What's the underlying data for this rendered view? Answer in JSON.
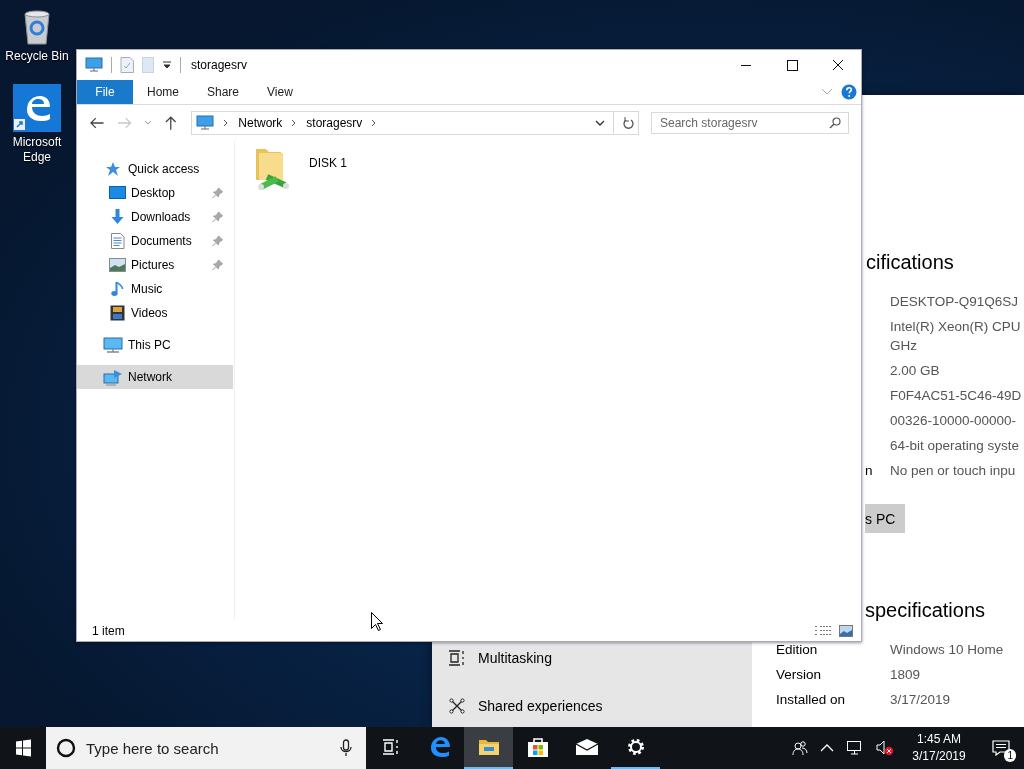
{
  "desktop_icons": [
    {
      "label": "Recycle Bin",
      "kind": "recycle"
    },
    {
      "label": "Microsoft Edge",
      "kind": "edge"
    }
  ],
  "settings_window": {
    "nav_items": [
      {
        "label": "Multitasking",
        "kind": "multitasking"
      },
      {
        "label": "Shared experiences",
        "kind": "shared"
      }
    ],
    "sections": [
      {
        "heading": "cifications",
        "rows": [
          {
            "value": "DESKTOP-Q91Q6SJ"
          },
          {
            "value": "Intel(R) Xeon(R) CPU",
            "value_2": "GHz"
          },
          {
            "value": "2.00 GB"
          },
          {
            "value": "F0F4AC51-5C46-49D"
          },
          {
            "value": "00326-10000-00000-"
          },
          {
            "value": "64-bit operating syste"
          },
          {
            "label": "n",
            "value": "No pen or touch inpu"
          }
        ],
        "button": "s PC"
      },
      {
        "heading": "specifications",
        "rows": [
          {
            "label": "Edition",
            "value": "Windows 10 Home"
          },
          {
            "label": "Version",
            "value": "1809"
          },
          {
            "label": "Installed on",
            "value": "3/17/2019"
          }
        ]
      }
    ]
  },
  "explorer": {
    "title": "storagesrv",
    "ribbon_tabs": [
      {
        "label": "File",
        "kind": "file"
      },
      {
        "label": "Home",
        "kind": "tab"
      },
      {
        "label": "Share",
        "kind": "tab"
      },
      {
        "label": "View",
        "kind": "tab"
      }
    ],
    "address": {
      "crumbs": [
        "Network",
        "storagesrv"
      ]
    },
    "search": {
      "placeholder": "Search storagesrv"
    },
    "nav_tree": [
      {
        "label": "Quick access",
        "kind": "star",
        "selected": false,
        "children": [
          {
            "label": "Desktop",
            "kind": "desktop",
            "pinned": true,
            "selected": false
          },
          {
            "label": "Downloads",
            "kind": "downloads",
            "pinned": true,
            "selected": false
          },
          {
            "label": "Documents",
            "kind": "documents",
            "pinned": true,
            "selected": false
          },
          {
            "label": "Pictures",
            "kind": "pictures",
            "pinned": true,
            "selected": false
          },
          {
            "label": "Music",
            "kind": "music",
            "pinned": false,
            "selected": false
          },
          {
            "label": "Videos",
            "kind": "videos",
            "pinned": false,
            "selected": false
          }
        ]
      },
      {
        "label": "This PC",
        "kind": "pc",
        "selected": false
      },
      {
        "label": "Network",
        "kind": "network",
        "selected": true
      }
    ],
    "items": [
      {
        "name": "DISK 1"
      }
    ],
    "status": "1 item"
  },
  "taskbar": {
    "search": {
      "placeholder": "Type here to search"
    },
    "apps": [
      {
        "kind": "taskview",
        "running": false,
        "active": false
      },
      {
        "kind": "edge",
        "running": false,
        "active": false
      },
      {
        "kind": "explorer",
        "running": true,
        "active": true
      },
      {
        "kind": "store",
        "running": false,
        "active": false
      },
      {
        "kind": "mail",
        "running": false,
        "active": false
      },
      {
        "kind": "settings",
        "running": true,
        "active": false
      }
    ],
    "clock": {
      "time": "1:45 AM",
      "date": "3/17/2019"
    },
    "notifications": "1"
  }
}
